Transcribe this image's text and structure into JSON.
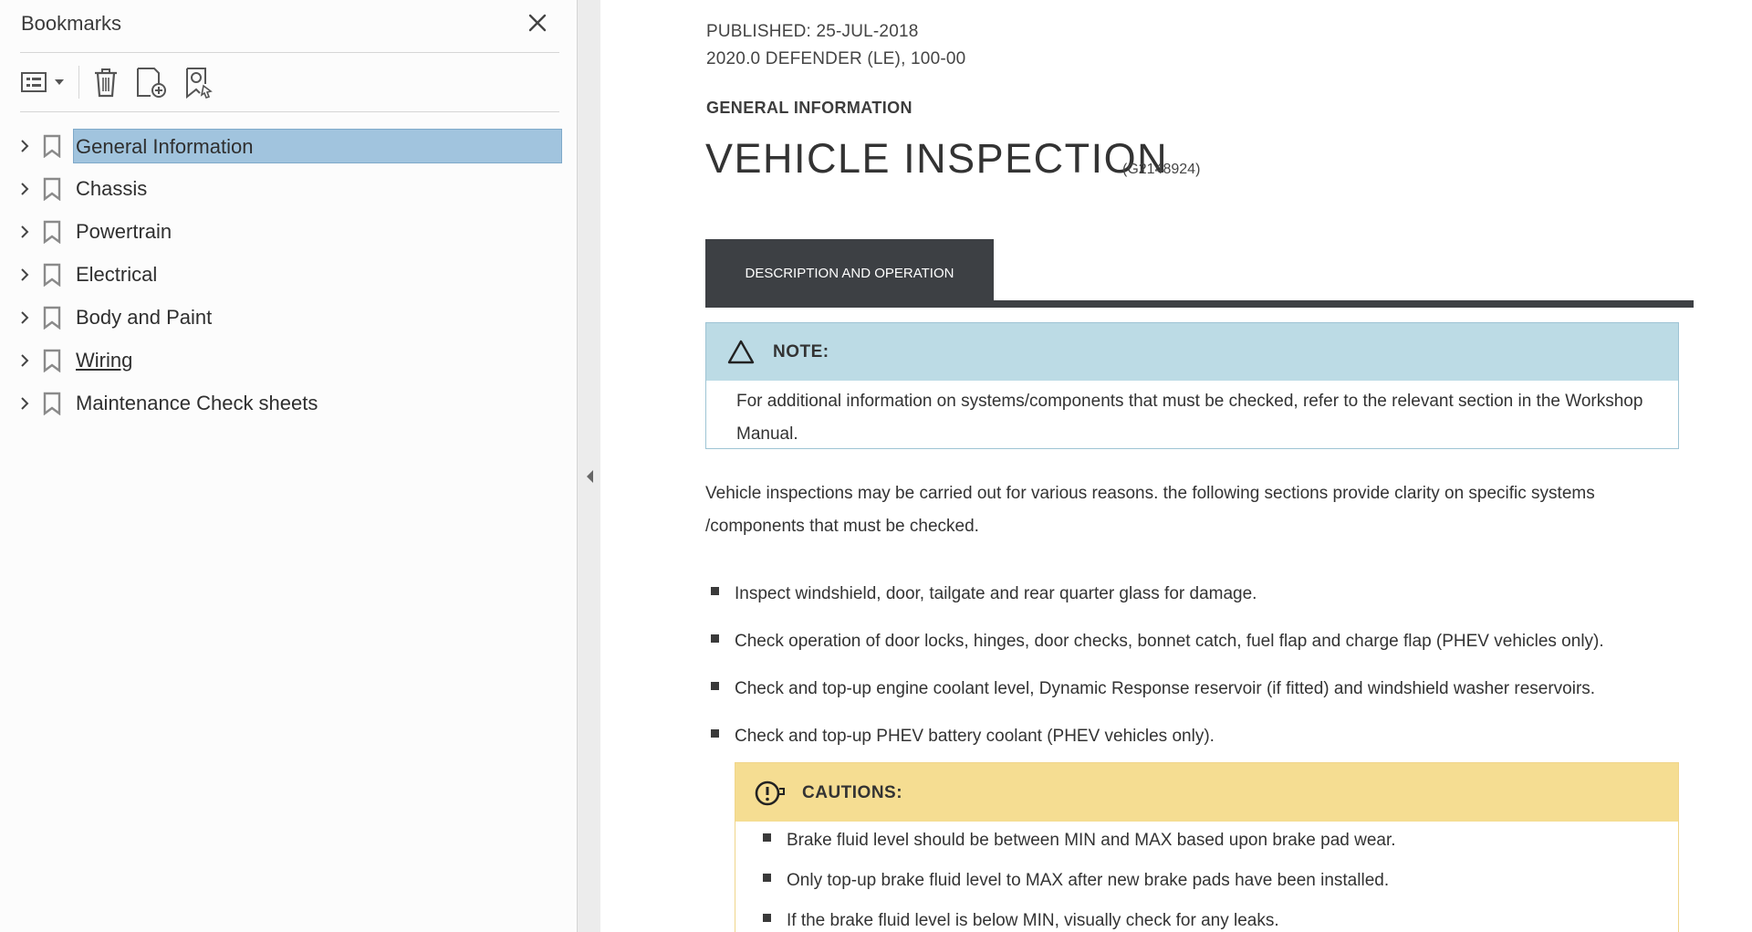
{
  "bookmarks_panel": {
    "title": "Bookmarks",
    "items": [
      {
        "label": "General Information",
        "selected": true
      },
      {
        "label": "Chassis"
      },
      {
        "label": "Powertrain"
      },
      {
        "label": "Electrical"
      },
      {
        "label": "Body and Paint"
      },
      {
        "label": "Wiring",
        "underlined": true
      },
      {
        "label": "Maintenance Check sheets"
      }
    ],
    "toolbar_icons": [
      "options-list-icon",
      "delete-bookmark-icon",
      "new-bookmark-icon",
      "find-current-bookmark-icon"
    ]
  },
  "document": {
    "published": "PUBLISHED: 25-JUL-2018",
    "model": "2020.0 DEFENDER (LE), 100-00",
    "section": "GENERAL INFORMATION",
    "title": "VEHICLE INSPECTION",
    "code": "(G2148924)",
    "tab_label": "DESCRIPTION AND OPERATION",
    "note": {
      "title": "NOTE:",
      "text": "For additional information on systems/components that must be checked, refer to the relevant section in the Workshop Manual."
    },
    "intro": "Vehicle inspections may be carried out for various reasons. the following sections provide clarity on specific systems /components that must be checked.",
    "checks": [
      "Inspect windshield, door, tailgate and rear quarter glass for damage.",
      "Check operation of door locks, hinges, door checks, bonnet catch, fuel flap and charge flap (PHEV vehicles only).",
      "Check and top-up engine coolant level, Dynamic Response reservoir (if fitted) and windshield washer reservoirs.",
      "Check and top-up PHEV battery coolant (PHEV vehicles only)."
    ],
    "cautions": {
      "title": "CAUTIONS:",
      "items": [
        "Brake fluid level should be between MIN and MAX based upon brake pad wear.",
        "Only top-up brake fluid level to MAX after new brake pads have been installed.",
        "If the brake fluid level is below MIN, visually check for any leaks."
      ]
    }
  },
  "colors": {
    "selection": "#a1c4de",
    "note_header": "#bcdbe5",
    "caution_header": "#f5dd92",
    "tab_dark": "#3d4044"
  }
}
